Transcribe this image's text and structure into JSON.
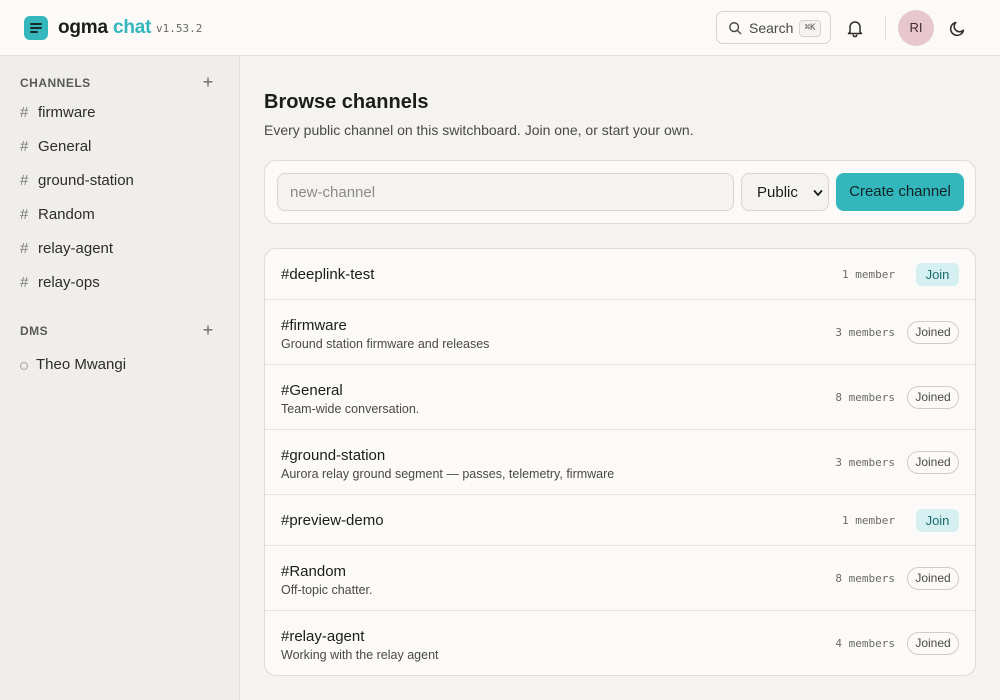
{
  "app": {
    "brand_primary": "ogma",
    "brand_accent": "chat",
    "version": "v1.53.2",
    "accent_color": "#33b7bd"
  },
  "header": {
    "search_label": "Search",
    "search_shortcut": "⌘K",
    "avatar_initials": "RI",
    "icons": [
      "search-icon",
      "bell-icon",
      "moon-icon"
    ]
  },
  "sidebar": {
    "channels_title": "CHANNELS",
    "channels": [
      {
        "label": "firmware"
      },
      {
        "label": "General"
      },
      {
        "label": "ground-station"
      },
      {
        "label": "Random"
      },
      {
        "label": "relay-agent"
      },
      {
        "label": "relay-ops"
      }
    ],
    "dms_title": "DMS",
    "dms": [
      {
        "label": "Theo Mwangi",
        "status": "offline"
      }
    ]
  },
  "main": {
    "title": "Browse channels",
    "subtitle": "Every public channel on this switchboard. Join one, or start your own.",
    "create": {
      "placeholder": "new-channel",
      "visibility": "Public",
      "button_label": "Create channel"
    },
    "channels": [
      {
        "name": "deeplink-test",
        "desc": "",
        "members": "1 member",
        "action": "Join"
      },
      {
        "name": "firmware",
        "desc": "Ground station firmware and releases",
        "members": "3 members",
        "action": "Joined"
      },
      {
        "name": "General",
        "desc": "Team-wide conversation.",
        "members": "8 members",
        "action": "Joined"
      },
      {
        "name": "ground-station",
        "desc": "Aurora relay ground segment — passes, telemetry, firmware",
        "members": "3 members",
        "action": "Joined"
      },
      {
        "name": "preview-demo",
        "desc": "",
        "members": "1 member",
        "action": "Join"
      },
      {
        "name": "Random",
        "desc": "Off-topic chatter.",
        "members": "8 members",
        "action": "Joined"
      },
      {
        "name": "relay-agent",
        "desc": "Working with the relay agent",
        "members": "4 members",
        "action": "Joined"
      }
    ]
  }
}
